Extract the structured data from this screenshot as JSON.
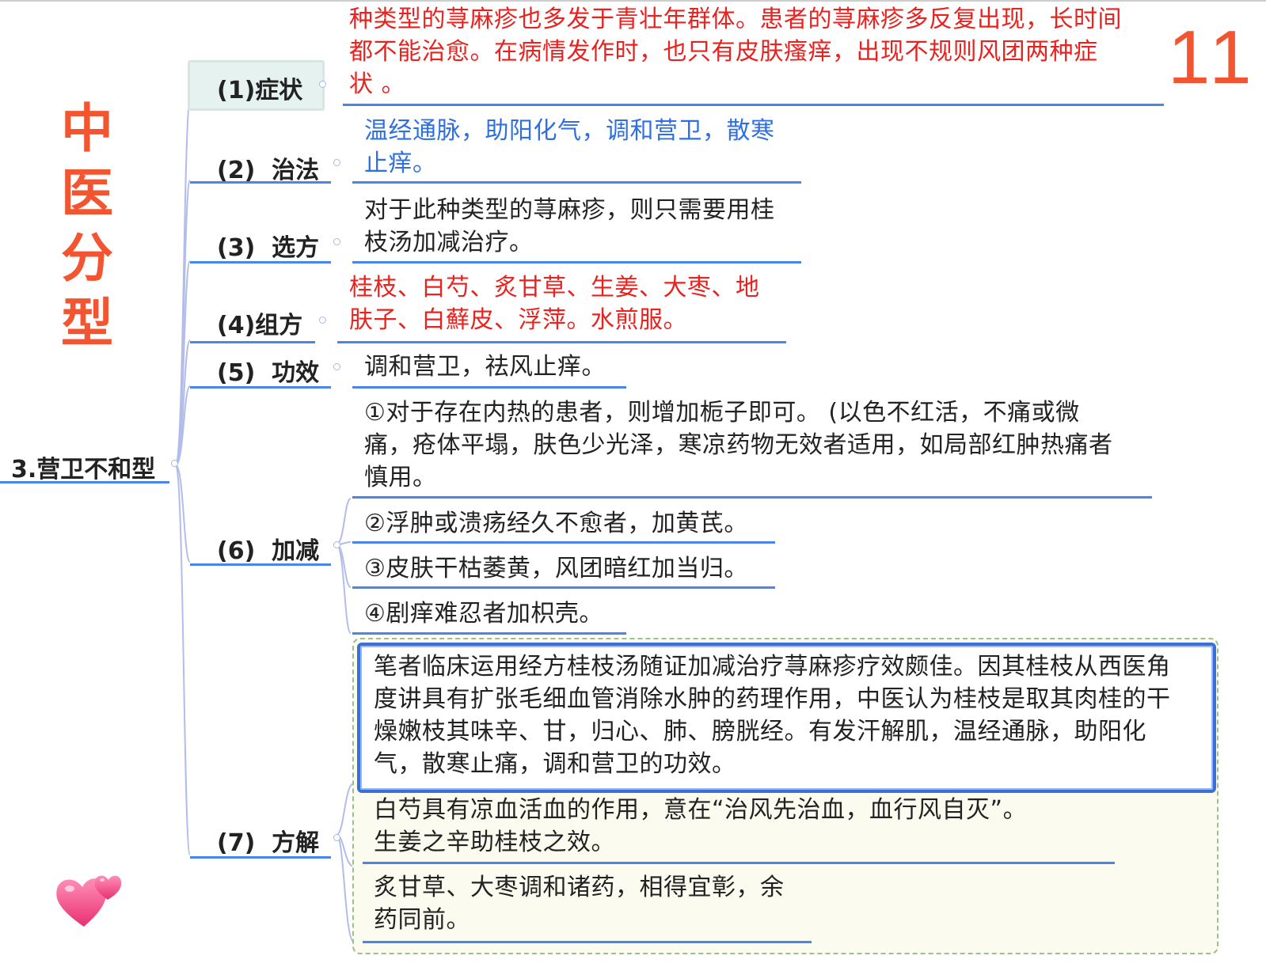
{
  "page_number": "11",
  "vertical_title": [
    "中",
    "医",
    "分",
    "型"
  ],
  "root": {
    "label": "3.营卫不和型"
  },
  "branches": [
    {
      "label": "(1)症状",
      "text": "种类型的荨麻疹也多发于青壮年群体。患者的荨麻疹多反复出现，长时间\n都不能治愈。在病情发作时，也只有皮肤瘙痒，出现不规则风团两种症\n状 。"
    },
    {
      "label": "(2)  治法",
      "text": "温经通脉，助阳化气，调和营卫，散寒\n止痒。"
    },
    {
      "label": "(3)  选方",
      "text": "对于此种类型的荨麻疹，则只需要用桂\n枝汤加减治疗。"
    },
    {
      "label": "(4)组方",
      "text": "桂枝、白芍、炙甘草、生姜、大枣、地\n肤子、白蘚皮、浮萍。水煎服。"
    },
    {
      "label": "(5)  功效",
      "text": "调和营卫，祛风止痒。"
    },
    {
      "label": "(6)  加减",
      "items": [
        "①对于存在内热的患者，则增加栀子即可。 (以色不红活，不痛或微\n痛，疮体平塌，肤色少光泽，寒凉药物无效者适用，如局部红肿热痛者\n慎用。",
        "②浮肿或溃疡经久不愈者，加黄芪。",
        "③皮肤干枯萎黄，风团暗红加当归。",
        "④剧痒难忍者加枳壳。"
      ]
    },
    {
      "label": "(7)  方解",
      "items": [
        "笔者临床运用经方桂枝汤随证加减治疗荨麻疹疗效颇佳。因其桂枝从西医角\n度讲具有扩张毛细血管消除水肿的药理作用，中医认为桂枝是取其肉桂的干\n燥嫩枝其味辛、甘，归心、肺、膀胱经。有发汗解肌，温经通脉，助阳化\n气，散寒止痛，调和营卫的功效。",
        "白芍具有凉血活血的作用，意在“治风先治血，血行风自灭”。\n生姜之辛助桂枝之效。",
        "炙甘草、大枣调和诸药，相得宜彰，余\n药同前。"
      ]
    }
  ],
  "colors": {
    "accent_line": "#4a86e8",
    "title_orange": "#f25530",
    "red_text": "#e8231f",
    "blue_text": "#2f6fe0"
  },
  "decor": {
    "heart_icon": "pink-hearts-icon"
  }
}
